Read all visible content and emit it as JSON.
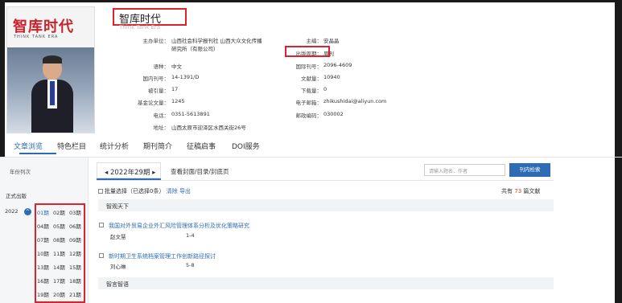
{
  "magazine": {
    "cover_title": "智库时代",
    "cover_subtitle": "THINK TANK ERA",
    "title": "智库时代",
    "title_en": "Think Tank Era"
  },
  "info": {
    "sponsor_label": "主办单位：",
    "sponsor_value_1": "山西社会科学报刊社 山西大众文化传播",
    "sponsor_value_2": "研究所（有限公司）",
    "editor_label": "主编：",
    "editor_value": "安晶晶",
    "cycle_label": "出版周期：",
    "cycle_value": "周刊",
    "language_label": "语种：",
    "language_value": "中文",
    "issn_label": "国际刊号：",
    "issn_value": "2096-4609",
    "cn_label": "国内刊号：",
    "cn_value": "14-1391/D",
    "articles_label": "文献量：",
    "articles_value": "10940",
    "citations_label": "被引量：",
    "citations_value": "17",
    "downloads_label": "下载量：",
    "downloads_value": "0",
    "fund_label": "基金论文量：",
    "fund_value": "1245",
    "email_label": "电子邮箱：",
    "email_value": "zhikushidai@aliyun.com",
    "phone_label": "电话：",
    "phone_value": "0351-5613891",
    "postcode_label": "邮政编码：",
    "postcode_value": "030002",
    "address_label": "地址：",
    "address_value": "山西太原市迎泽区水西关街26号"
  },
  "tabs": [
    "文章浏览",
    "特色栏目",
    "统计分析",
    "期刊简介",
    "征稿启事",
    "DOI服务"
  ],
  "left": {
    "heading": "年份列次",
    "section": "正式出版",
    "year": "2022",
    "issues": [
      [
        "01期",
        "02期",
        "03期"
      ],
      [
        "04期",
        "05期",
        "06期"
      ],
      [
        "07期",
        "08期",
        "09期"
      ],
      [
        "10期",
        "11期",
        "12期"
      ],
      [
        "13期",
        "14期",
        "15期"
      ],
      [
        "16期",
        "17期",
        "18期"
      ],
      [
        "19期",
        "20期",
        "21期"
      ]
    ]
  },
  "main": {
    "issue_tab": "2022年29期",
    "view_cover": "查看封面/目录/封底页",
    "search_placeholder": "请输入题名、作者",
    "search_button": "刊内检索",
    "bulk_select": "批量选择（已选择0条）",
    "clear": "清除",
    "export": "导出",
    "total_prefix": "共有",
    "total_count": "73",
    "total_suffix": "篇文献",
    "sections": [
      {
        "name": "智观天下",
        "articles": [
          {
            "title": "我国对外贸易企业外汇风险管理体系分析及优化策略研究",
            "author": "赵文慧",
            "pages": "1-4"
          },
          {
            "title": "新时期卫生系统档案管理工作创新路径探讨",
            "author": "刘心琳",
            "pages": "5-8"
          }
        ]
      },
      {
        "name": "智言智语",
        "articles": []
      }
    ]
  }
}
